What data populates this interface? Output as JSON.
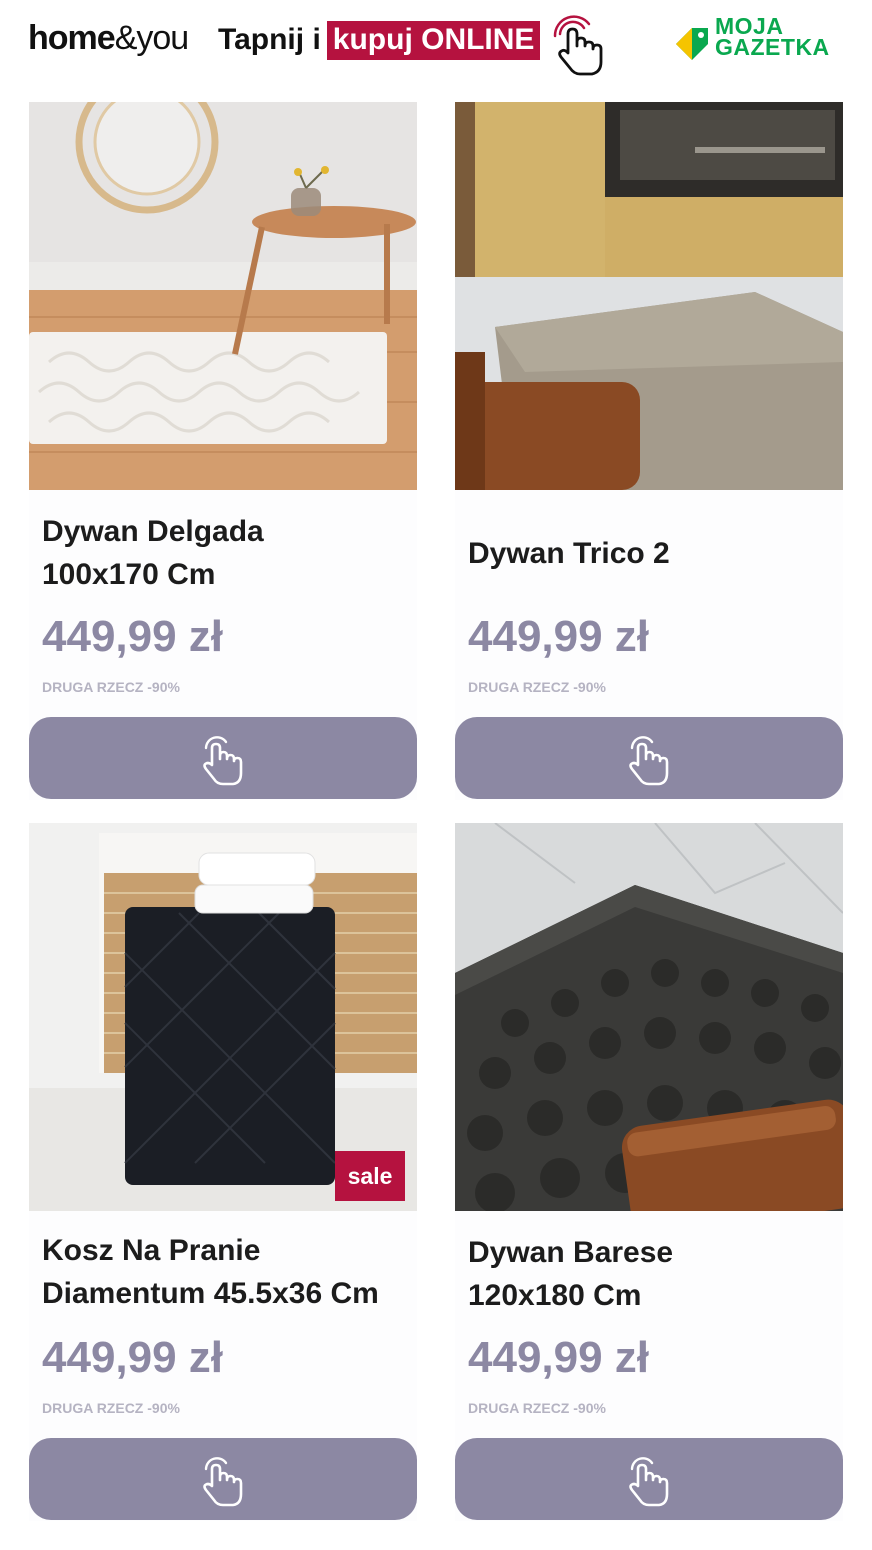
{
  "header": {
    "brand_bold": "home",
    "brand_light": "&you",
    "cta_plain": "Tapnij i",
    "cta_highlight": "kupuj ONLINE",
    "partner_line1": "MOJA",
    "partner_line2": "GAZETKA",
    "hand_icon": "pointing-hand-icon",
    "partner_icon": "price-tag-icon"
  },
  "colors": {
    "accent_red": "#b5123f",
    "button_purple": "#8c88a3",
    "price_purple": "#8c88a3",
    "partner_green": "#0aa84f"
  },
  "products": [
    {
      "title_line1": "Dywan Delgada",
      "title_line2": "100x170 Cm",
      "price": "449,99 zł",
      "promo": "DRUGA RZECZ -90%",
      "image": "white textured rug in living room with wooden side table",
      "button_icon": "tap-hand-icon"
    },
    {
      "title_line1": "Dywan Trico 2",
      "title_line2": "",
      "price": "449,99 zł",
      "promo": "DRUGA RZECZ -90%",
      "image": "grey rug on marble floor by fireplace",
      "button_icon": "tap-hand-icon"
    },
    {
      "title_line1": "Kosz Na Pranie",
      "title_line2": "Diamentum 45.5x36 Cm",
      "price": "449,99 zł",
      "promo": "DRUGA RZECZ -90%",
      "badge": "sale",
      "image": "black quilted laundry basket with towels",
      "button_icon": "tap-hand-icon"
    },
    {
      "title_line1": "Dywan Barese",
      "title_line2": "120x180 Cm",
      "price": "449,99 zł",
      "promo": "DRUGA RZECZ -90%",
      "image": "dark bubble textured rug on marble floor",
      "button_icon": "tap-hand-icon"
    }
  ]
}
